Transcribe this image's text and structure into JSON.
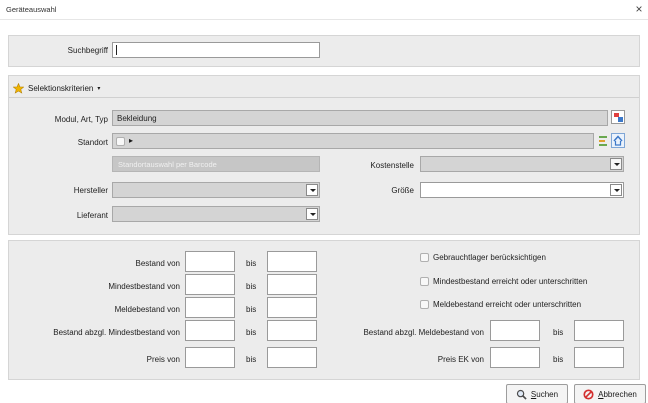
{
  "window": {
    "title": "Geräteauswahl",
    "close_glyph": "×"
  },
  "search": {
    "label": "Suchbegriff",
    "value": ""
  },
  "criteria": {
    "label": "Selektionskriterien",
    "caret": "▾"
  },
  "modul": {
    "label": "Modul, Art, Typ",
    "value": "Bekleidung"
  },
  "standort": {
    "label": "Standort",
    "value": "",
    "marker": "▸",
    "barcode_placeholder": "Standortauswahl per Barcode"
  },
  "kostenstelle": {
    "label": "Kostenstelle",
    "value": ""
  },
  "hersteller": {
    "label": "Hersteller",
    "value": ""
  },
  "groesse": {
    "label": "Größe",
    "value": ""
  },
  "lieferant": {
    "label": "Lieferant",
    "value": ""
  },
  "ranges": {
    "bis": "bis",
    "bestand": {
      "label": "Bestand von"
    },
    "mindestbestand": {
      "label": "Mindestbestand von"
    },
    "meldebestand": {
      "label": "Meldebestand von"
    },
    "bestand_mindest": {
      "label": "Bestand abzgl. Mindestbestand von"
    },
    "preis": {
      "label": "Preis von"
    },
    "bestand_melde": {
      "label": "Bestand abzgl. Meldebestand von"
    },
    "preis_ek": {
      "label": "Preis EK von"
    }
  },
  "checkboxes": {
    "gebrauchtlager": {
      "label": "Gebrauchtlager berücksichtigen",
      "checked": false
    },
    "mindest": {
      "label": "Mindestbestand erreicht oder unterschritten",
      "checked": false
    },
    "melde": {
      "label": "Meldebestand erreicht oder unterschritten",
      "checked": false
    }
  },
  "buttons": {
    "suchen": {
      "first": "S",
      "rest": "uchen"
    },
    "abbrechen": {
      "first": "A",
      "rest": "bbrechen"
    }
  },
  "colors": {
    "star": "#f0b400",
    "abort_icon": "#d33030",
    "refresh_icon": "#3c78c8"
  },
  "icons": [
    "close-icon",
    "star-icon",
    "picker-icon",
    "tree-icon",
    "refresh-icon",
    "search-icon",
    "cancel-icon"
  ]
}
